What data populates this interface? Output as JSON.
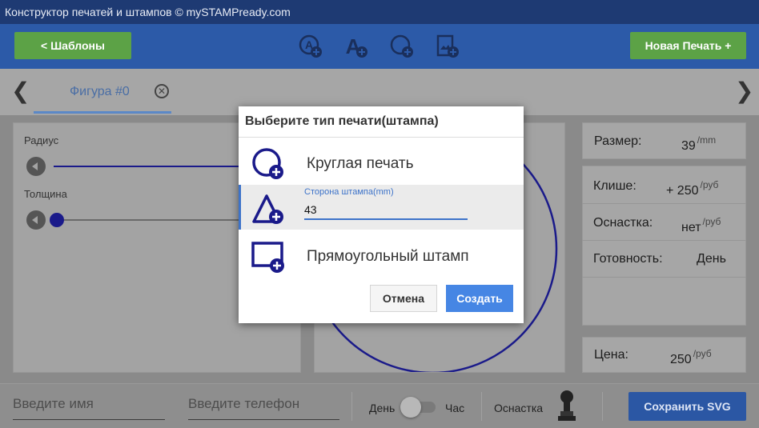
{
  "app": {
    "title": "Конструктор печатей и штампов © mySTAMPready.com"
  },
  "toolbar": {
    "templates_label": "<  Шаблоны",
    "new_stamp_label": "Новая Печать +",
    "tools": [
      "add-circle-text-icon",
      "add-text-icon",
      "add-circle-icon",
      "add-image-icon"
    ]
  },
  "tabs": {
    "active_label": "Фигура #0"
  },
  "settings": {
    "radius_label": "Радиус",
    "thickness_label": "Толщина"
  },
  "info": {
    "size_label": "Размер:",
    "size_value": "39",
    "size_unit": "/mm",
    "cliche_label": "Клише:",
    "cliche_value": "+ 250",
    "cliche_unit": "/руб",
    "equipment_label": "Оснастка:",
    "equipment_value": "нет",
    "equipment_unit": "/руб",
    "readiness_label": "Готовность:",
    "readiness_value": "День",
    "price_label": "Цена:",
    "price_value": "250",
    "price_unit": "/руб"
  },
  "bottom": {
    "name_placeholder": "Введите имя",
    "phone_placeholder": "Введите телефон",
    "day_label": "День",
    "hour_label": "Час",
    "equipment_label": "Оснастка",
    "save_label": "Сохранить SVG"
  },
  "dialog": {
    "title": "Выберите тип печати(штампа)",
    "option_round": "Круглая печать",
    "triangle_caption": "Сторона штампа(mm)",
    "triangle_value": "43",
    "option_rect": "Прямоугольный штамп",
    "cancel_label": "Отмена",
    "create_label": "Создать"
  },
  "colors": {
    "brand": "#2c5aa8",
    "accent_green": "#5ca246",
    "stamp_blue": "#1a1a8a",
    "dialog_blue": "#4686e4"
  }
}
